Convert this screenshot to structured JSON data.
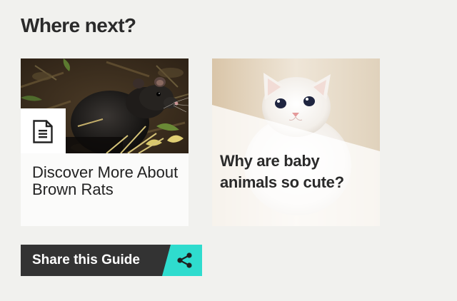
{
  "section": {
    "heading": "Where next?"
  },
  "cards": [
    {
      "title": "Discover More About Brown Rats",
      "type_icon": "document-icon",
      "image": "brown-rat-photo"
    },
    {
      "title": "Why are baby animals so cute?",
      "image": "white-kitten-photo"
    }
  ],
  "share": {
    "label": "Share this Guide",
    "icon": "share-icon",
    "colors": {
      "bar": "#333333",
      "accent": "#2fdcce"
    }
  }
}
